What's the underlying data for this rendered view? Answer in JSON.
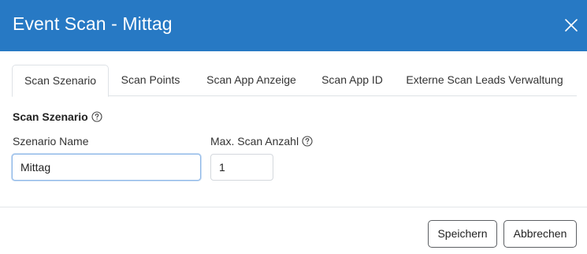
{
  "dialog": {
    "title": "Event Scan - Mittag",
    "close_icon": "close-icon"
  },
  "tabs": [
    {
      "label": "Scan Szenario",
      "active": true
    },
    {
      "label": "Scan Points",
      "active": false
    },
    {
      "label": "Scan App Anzeige",
      "active": false
    },
    {
      "label": "Scan App ID",
      "active": false
    },
    {
      "label": "Externe Scan Leads Verwaltung",
      "active": false
    }
  ],
  "section": {
    "title": "Scan Szenario",
    "help_icon": "question-circle-icon"
  },
  "form": {
    "scenario_name_label": "Szenario Name",
    "scenario_name_value": "Mittag",
    "max_scan_label": "Max. Scan Anzahl",
    "max_scan_value": "1"
  },
  "footer": {
    "save_label": "Speichern",
    "cancel_label": "Abbrechen"
  },
  "colors": {
    "header_bg": "#2779c4",
    "header_text": "#ffffff"
  }
}
